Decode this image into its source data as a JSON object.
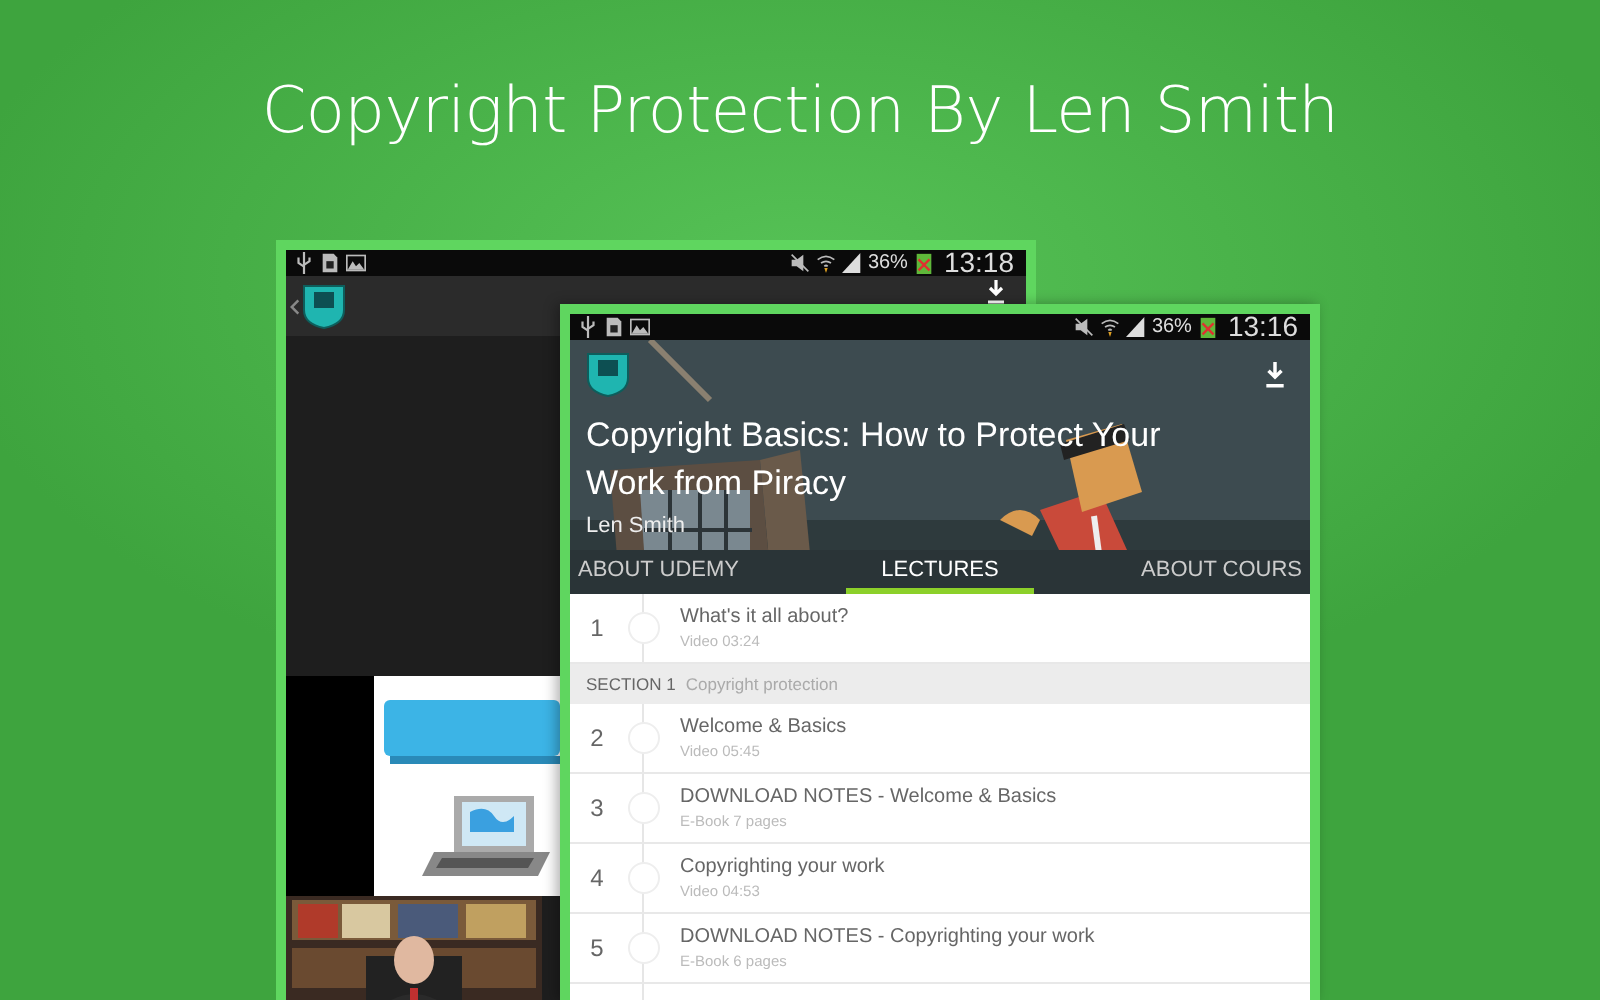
{
  "title": "Copyright Protection By Len Smith",
  "back_phone": {
    "status": {
      "battery": "36%",
      "time": "13:18"
    }
  },
  "front_phone": {
    "status": {
      "battery": "36%",
      "time": "13:16"
    },
    "course_title": "Copyright Basics: How to Protect Your Work from Piracy",
    "author": "Len Smith",
    "tabs": [
      {
        "label": "ABOUT UDEMY",
        "selected": false
      },
      {
        "label": "LECTURES",
        "selected": true
      },
      {
        "label": "ABOUT COURS",
        "selected": false
      }
    ],
    "lectures": [
      {
        "kind": "lecture",
        "number": "1",
        "title": "What's it all about?",
        "meta": "Video 03:24"
      },
      {
        "kind": "section",
        "section": "SECTION 1",
        "title": "Copyright protection"
      },
      {
        "kind": "lecture",
        "number": "2",
        "title": "Welcome & Basics",
        "meta": "Video 05:45"
      },
      {
        "kind": "lecture",
        "number": "3",
        "title": "DOWNLOAD NOTES - Welcome & Basics",
        "meta": "E-Book 7 pages"
      },
      {
        "kind": "lecture",
        "number": "4",
        "title": "Copyrighting your work",
        "meta": "Video 04:53"
      },
      {
        "kind": "lecture",
        "number": "5",
        "title": "DOWNLOAD NOTES - Copyrighting your work",
        "meta": "E-Book 6 pages"
      }
    ]
  }
}
